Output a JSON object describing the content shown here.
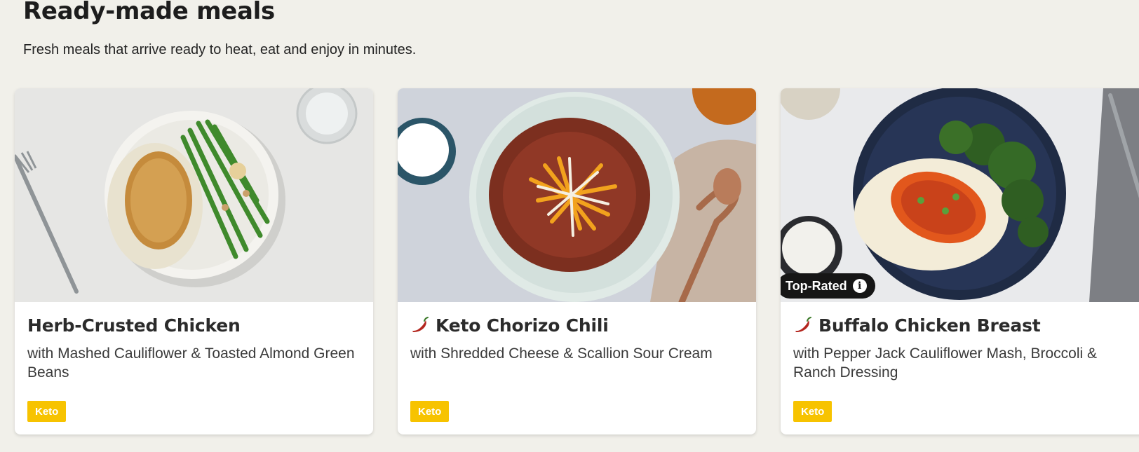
{
  "section": {
    "title": "Ready-made meals",
    "subtitle": "Fresh meals that arrive ready to heat, eat and enjoy in minutes."
  },
  "cards": [
    {
      "name": "Herb-Crusted Chicken",
      "description": "with Mashed Cauliflower & Toasted Almond Green Beans",
      "tag": "Keto",
      "spicy": false,
      "badge": null
    },
    {
      "name": "Keto Chorizo Chili",
      "description": "with Shredded Cheese & Scallion Sour Cream",
      "tag": "Keto",
      "spicy": true,
      "badge": null
    },
    {
      "name": "Buffalo Chicken Breast",
      "description": "with Pepper Jack Cauliflower Mash, Broccoli & Ranch Dressing",
      "tag": "Keto",
      "spicy": true,
      "badge": "Top-Rated"
    }
  ],
  "icons": {
    "spicy": "chili-pepper-icon",
    "info": "info-icon"
  },
  "colors": {
    "background": "#f1f0ea",
    "tag": "#f7c300",
    "badge": "#161616",
    "chili": "#b3261e"
  }
}
